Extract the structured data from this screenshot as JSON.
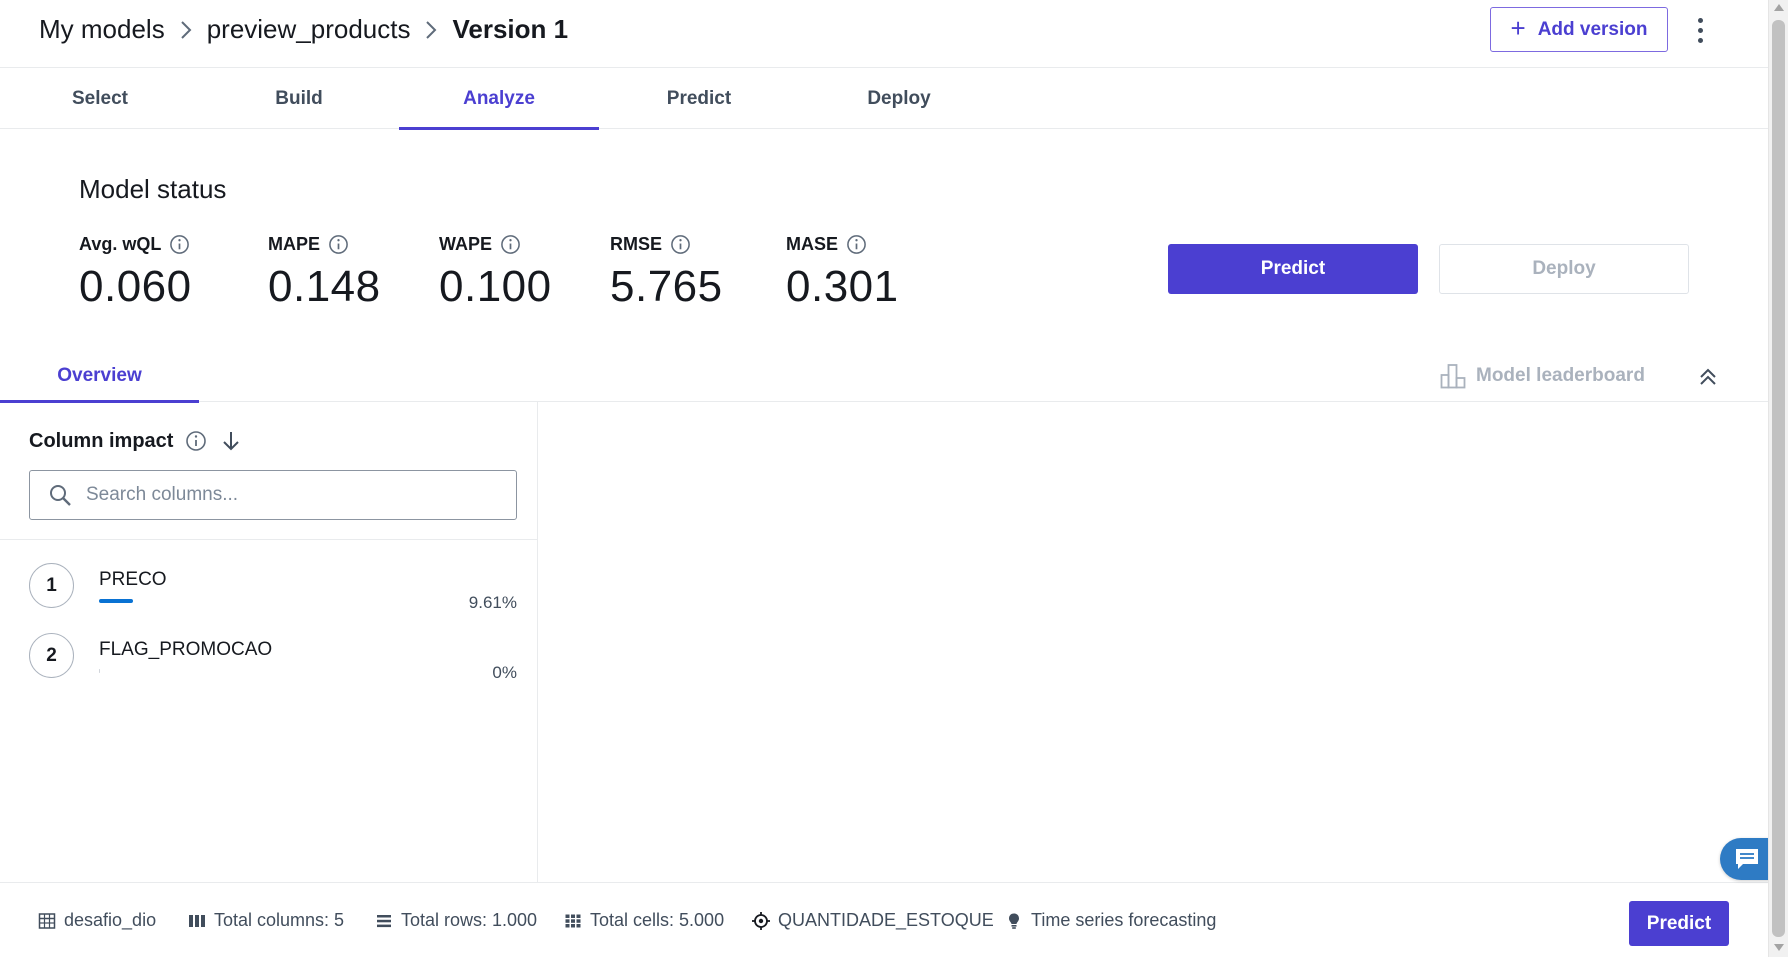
{
  "breadcrumb": {
    "items": [
      "My models",
      "preview_products",
      "Version 1"
    ]
  },
  "header": {
    "add_version_label": "Add version"
  },
  "main_tabs": [
    {
      "label": "Select",
      "active": false
    },
    {
      "label": "Build",
      "active": false
    },
    {
      "label": "Analyze",
      "active": true
    },
    {
      "label": "Predict",
      "active": false
    },
    {
      "label": "Deploy",
      "active": false
    }
  ],
  "model_status": {
    "title": "Model status",
    "metrics": [
      {
        "label": "Avg. wQL",
        "value": "0.060"
      },
      {
        "label": "MAPE",
        "value": "0.148"
      },
      {
        "label": "WAPE",
        "value": "0.100"
      },
      {
        "label": "RMSE",
        "value": "5.765"
      },
      {
        "label": "MASE",
        "value": "0.301"
      }
    ],
    "predict_label": "Predict",
    "deploy_label": "Deploy",
    "deploy_disabled": true
  },
  "sub_tabs": {
    "overview_label": "Overview",
    "leaderboard_label": "Model leaderboard"
  },
  "column_impact": {
    "title": "Column impact",
    "search_placeholder": "Search columns...",
    "rows": [
      {
        "rank": "1",
        "name": "PRECO",
        "percent_label": "9.61%",
        "percent": 9.61
      },
      {
        "rank": "2",
        "name": "FLAG_PROMOCAO",
        "percent_label": "0%",
        "percent": 0
      }
    ]
  },
  "footer": {
    "dataset": "desafio_dio",
    "total_columns": "Total columns: 5",
    "total_rows": "Total rows: 1.000",
    "total_cells": "Total cells: 5.000",
    "target": "QUANTIDADE_ESTOQUE",
    "model_type": "Time series forecasting",
    "predict_label": "Predict"
  },
  "colors": {
    "accent": "#4b3fd1",
    "impact_bar": "#0972d3",
    "chat_widget": "#2e7bc4"
  }
}
